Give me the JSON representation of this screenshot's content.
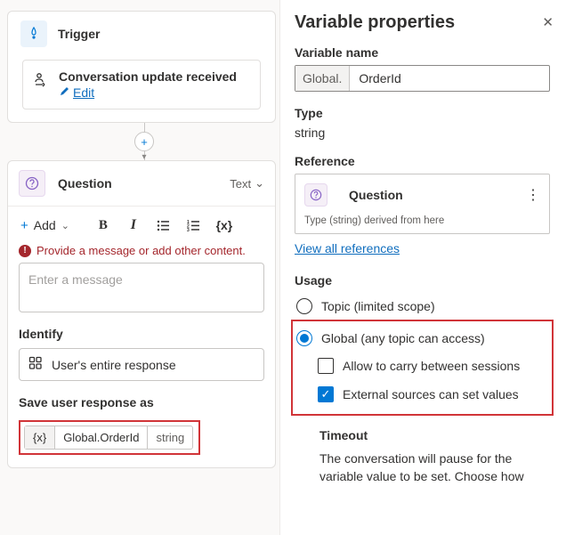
{
  "trigger": {
    "label": "Trigger",
    "event": "Conversation update received",
    "edit": "Edit"
  },
  "question": {
    "label": "Question",
    "output_type": "Text",
    "toolbar": {
      "add": "Add"
    },
    "error": "Provide a message or add other content.",
    "placeholder": "Enter a message",
    "identify_label": "Identify",
    "identify_value": "User's entire response",
    "save_label": "Save user response as",
    "variable": {
      "name": "Global.OrderId",
      "type": "string"
    }
  },
  "panel": {
    "title": "Variable properties",
    "name_label": "Variable name",
    "name_prefix": "Global.",
    "name_value": "OrderId",
    "type_label": "Type",
    "type_value": "string",
    "reference_label": "Reference",
    "reference_item": "Question",
    "reference_sub": "Type (string) derived from here",
    "view_all": "View all references",
    "usage_label": "Usage",
    "radio_topic": "Topic (limited scope)",
    "radio_global": "Global (any topic can access)",
    "cb_carry": "Allow to carry between sessions",
    "cb_external": "External sources can set values",
    "timeout_label": "Timeout",
    "timeout_text": "The conversation will pause for the variable value to be set. Choose how"
  }
}
